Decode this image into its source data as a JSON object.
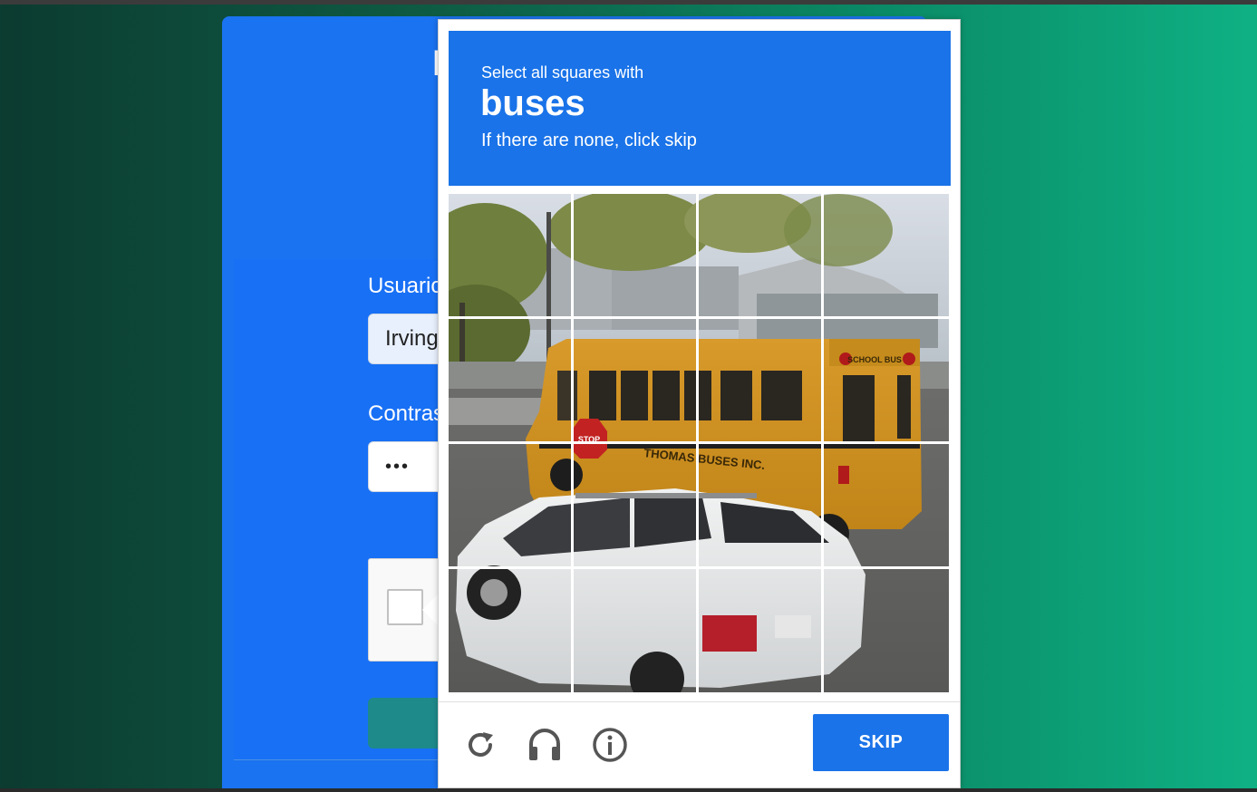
{
  "login": {
    "title_fragment": "I",
    "user_label": "Usuario",
    "user_value": "Irving",
    "pass_label": "Contraseña",
    "pass_value": "•••"
  },
  "challenge": {
    "instruction": "Select all squares with",
    "keyword": "buses",
    "hint": "If there are none, click skip",
    "grid_rows": 4,
    "grid_cols": 4,
    "image_text": [
      "STOP",
      "SCHOOL BUS",
      "THOMAS BUSES INC."
    ],
    "skip_label": "SKIP",
    "icons": [
      "reload-icon",
      "headphones-icon",
      "info-icon"
    ],
    "accent_color": "#1a73e8"
  }
}
